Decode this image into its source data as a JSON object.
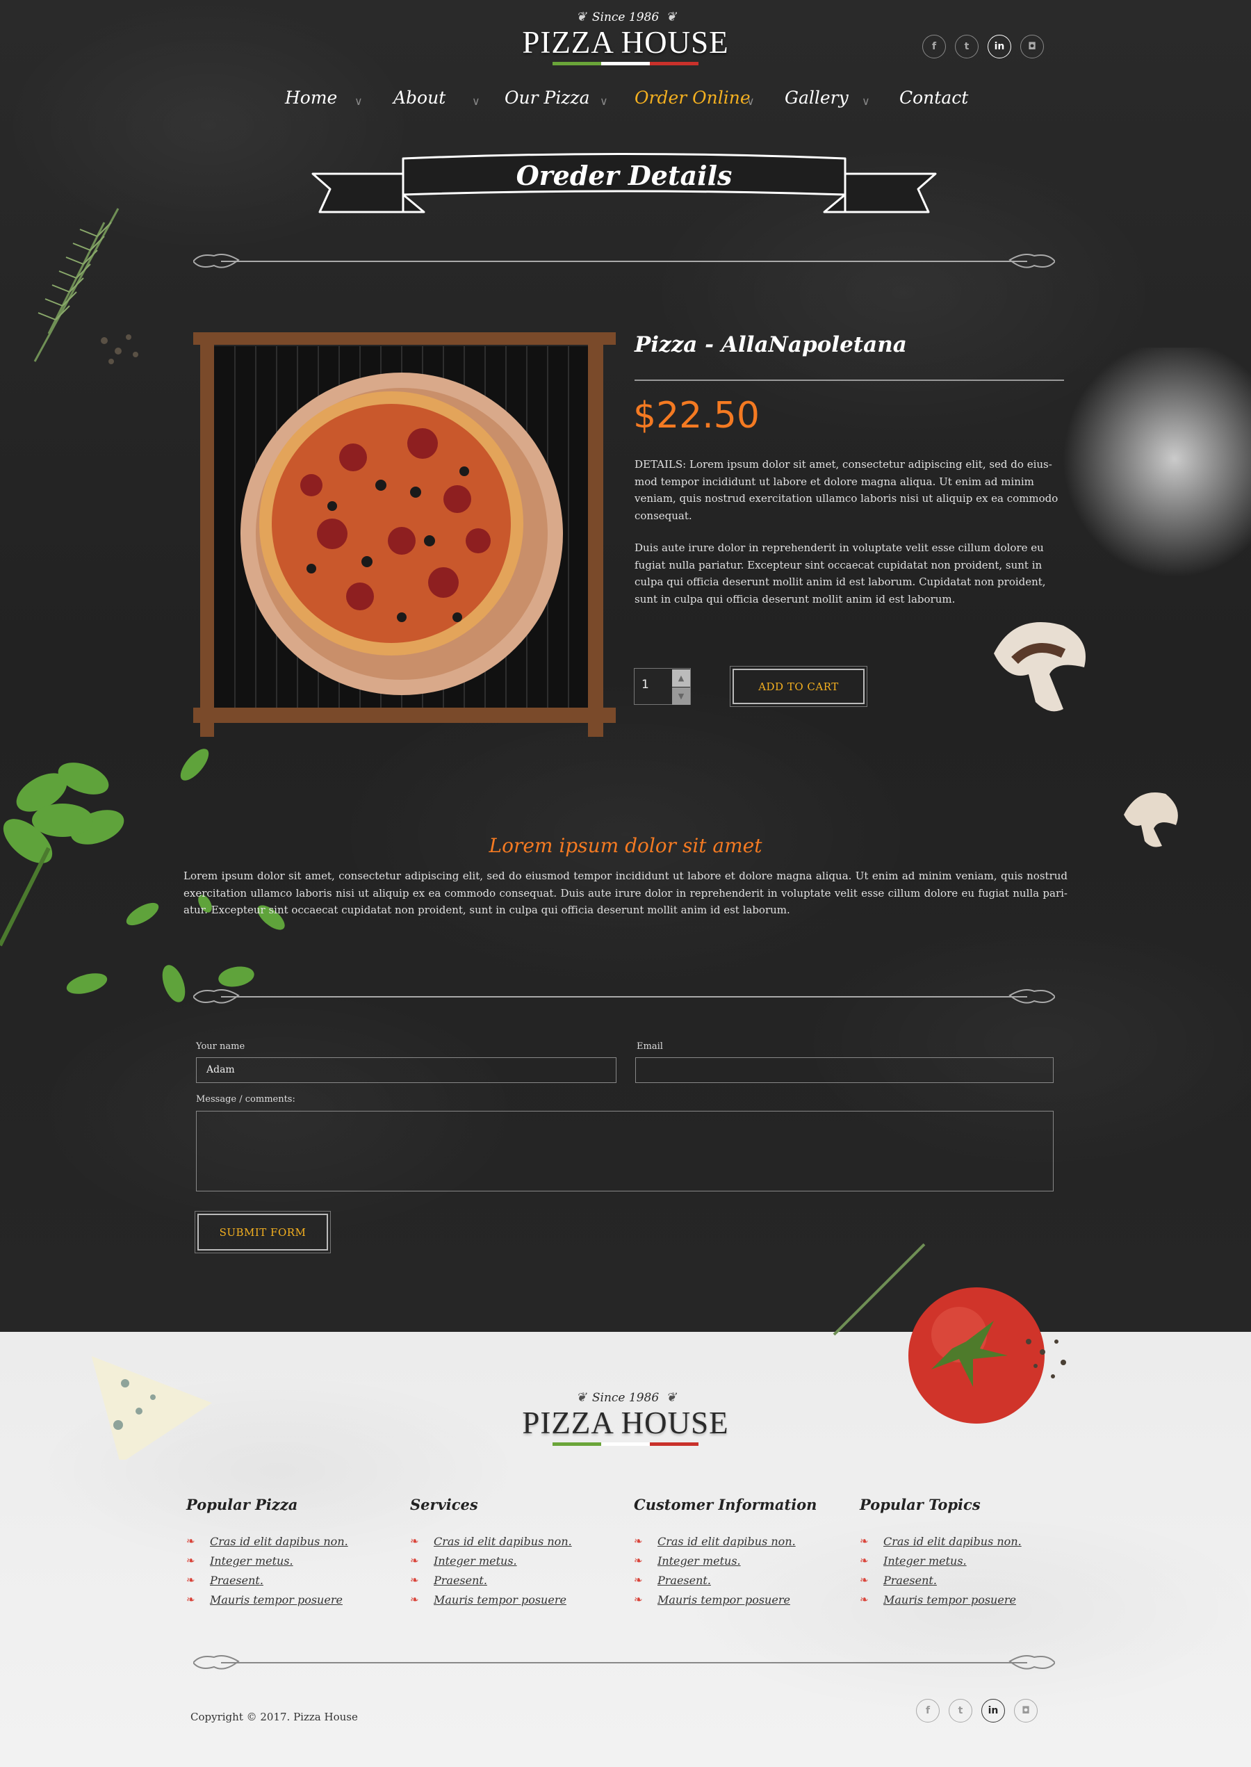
{
  "brand": {
    "since": "Since 1986",
    "name": "PIZZA HOUSE",
    "flag_colors": [
      "#6aa539",
      "#ffffff",
      "#c9312b"
    ]
  },
  "nav": {
    "items": [
      {
        "label": "Home",
        "active": false
      },
      {
        "label": "About",
        "active": false
      },
      {
        "label": "Our Pizza",
        "active": false
      },
      {
        "label": "Order Online",
        "active": true
      },
      {
        "label": "Gallery",
        "active": false
      },
      {
        "label": "Contact",
        "active": false
      }
    ],
    "separator_icon": "chevron-down-icon"
  },
  "social": [
    {
      "name": "facebook-icon",
      "glyph": "f",
      "active": false
    },
    {
      "name": "twitter-icon",
      "glyph": "t",
      "active": false
    },
    {
      "name": "linkedin-icon",
      "glyph": "in",
      "active": true
    },
    {
      "name": "instagram-icon",
      "glyph": "◘",
      "active": false
    }
  ],
  "page": {
    "title": "Oreder Details"
  },
  "product": {
    "name": "Pizza - AllaNapoletana",
    "price": "$22.50",
    "details": "DETAILS: Lorem ipsum dolor sit amet, consectetur adipiscing elit, sed do eius-mod tempor incididunt ut labore et dolore magna aliqua. Ut enim ad minim veniam, quis nostrud exercitation ullamco laboris nisi ut aliquip ex ea commodo consequat.",
    "details2": "Duis aute irure dolor in reprehenderit in voluptate velit esse cillum dolore eu fugiat nulla pariatur. Excepteur sint occaecat cupidatat non proident, sunt in culpa qui officia deserunt mollit anim id est laborum. Cupidatat non proident, sunt in culpa qui officia deserunt mollit anim id est laborum.",
    "quantity": "1",
    "add_to_cart": "ADD TO CART"
  },
  "info": {
    "title": "Lorem ipsum dolor sit amet",
    "text": "Lorem ipsum dolor sit amet, consectetur adipiscing elit, sed do eiusmod tempor incididunt ut labore et dolore magna aliqua. Ut enim ad minim veniam, quis nostrud exercitation ullamco laboris nisi ut aliquip ex ea commodo consequat. Duis aute irure dolor in reprehenderit in voluptate velit esse cillum dolore eu fugiat nulla pari-atur. Excepteur sint occaecat cupidatat non proident, sunt in culpa qui officia deserunt mollit anim id est laborum."
  },
  "form": {
    "name_label": "Your name",
    "name_value": "Adam",
    "email_label": "Email",
    "email_value": "",
    "message_label": "Message / comments:",
    "message_value": "",
    "submit": "SUBMIT FORM"
  },
  "footer": {
    "columns": [
      {
        "title": "Popular Pizza",
        "links": [
          "Cras id elit dapibus non.",
          "Integer metus.",
          "Praesent.",
          "Mauris tempor posuere"
        ]
      },
      {
        "title": "Services",
        "links": [
          "Cras id elit dapibus non.",
          "Integer metus.",
          "Praesent.",
          "Mauris tempor posuere"
        ]
      },
      {
        "title": "Customer Information",
        "links": [
          "Cras id elit dapibus non.",
          "Integer metus.",
          "Praesent.",
          "Mauris tempor posuere"
        ]
      },
      {
        "title": "Popular Topics",
        "links": [
          "Cras id elit dapibus non.",
          "Integer metus.",
          "Praesent.",
          "Mauris tempor posuere"
        ]
      }
    ],
    "copyright": "Copyright © 2017. Pizza House"
  },
  "colors": {
    "accent_orange": "#f47a22",
    "accent_gold": "#f4b020",
    "bullet_red": "#d9443a"
  }
}
